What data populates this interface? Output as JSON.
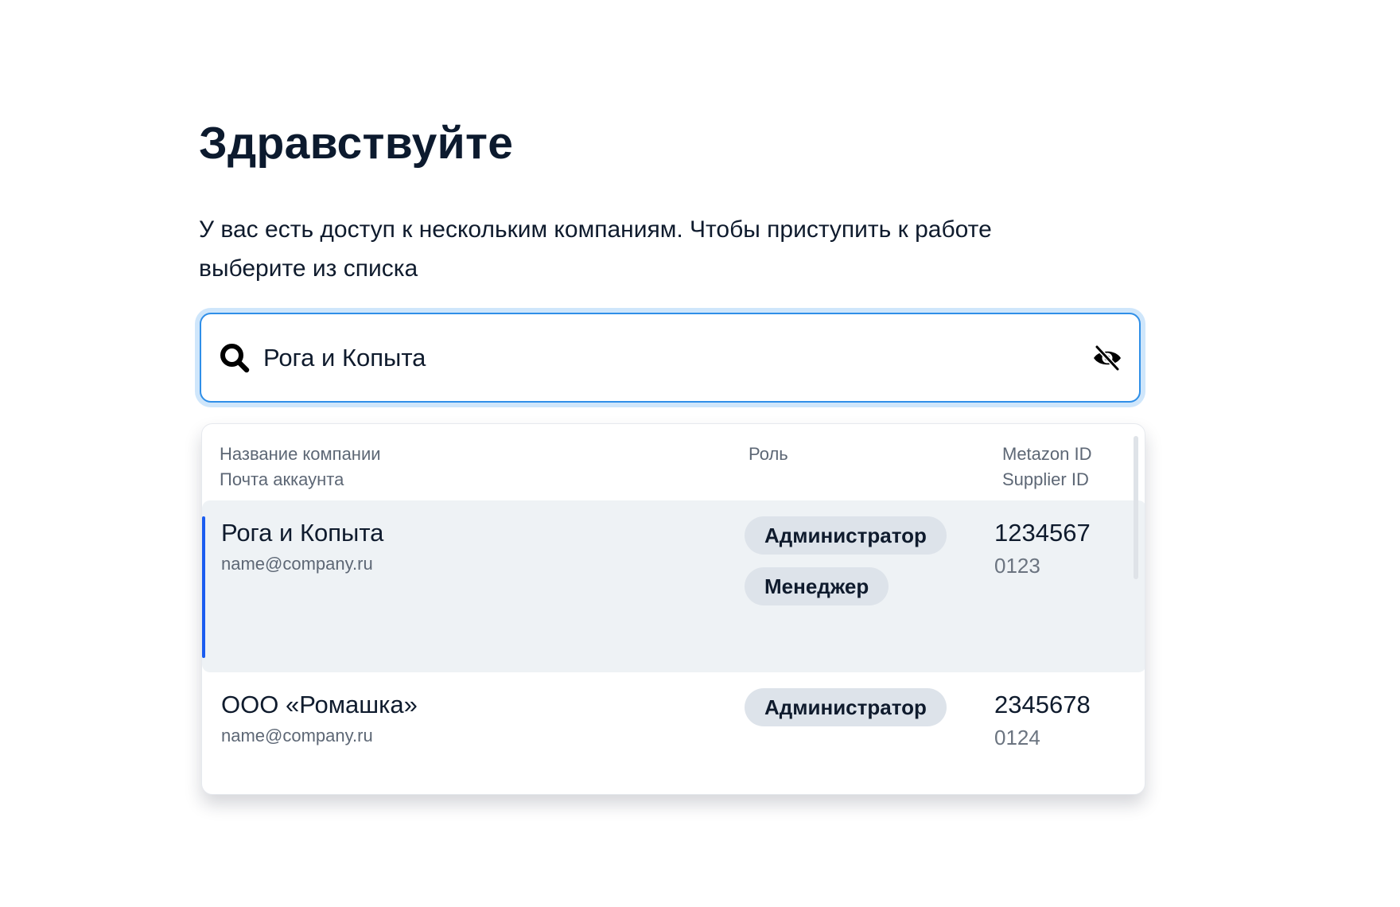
{
  "page": {
    "title": "Здравствуйте",
    "subtitle": "У вас есть доступ к нескольким компаниям. Чтобы приступить к работе выберите из списка"
  },
  "search": {
    "value": "Рога и Копыта",
    "icon": "search-icon",
    "clear_icon": "eye-off-icon",
    "focus_color": "#2f8fe8"
  },
  "table": {
    "headers": {
      "company_name": "Название компании",
      "account_email": "Почта аккаунта",
      "role": "Роль",
      "metazon_id": "Metazon ID",
      "supplier_id": "Supplier ID"
    },
    "rows": [
      {
        "company": "Рога и Копыта",
        "email": "name@company.ru",
        "roles": [
          "Администратор",
          "Менеджер"
        ],
        "metazon_id": "1234567",
        "supplier_id": "0123",
        "selected": true
      },
      {
        "company": "ООО «Ромашка»",
        "email": "name@company.ru",
        "roles": [
          "Администратор"
        ],
        "metazon_id": "2345678",
        "supplier_id": "0124",
        "selected": false
      }
    ]
  },
  "colors": {
    "accent": "#1a5cf0",
    "selected_row": "#eef2f5",
    "badge_bg": "#dde3ea",
    "title": "#0c1a2e"
  }
}
